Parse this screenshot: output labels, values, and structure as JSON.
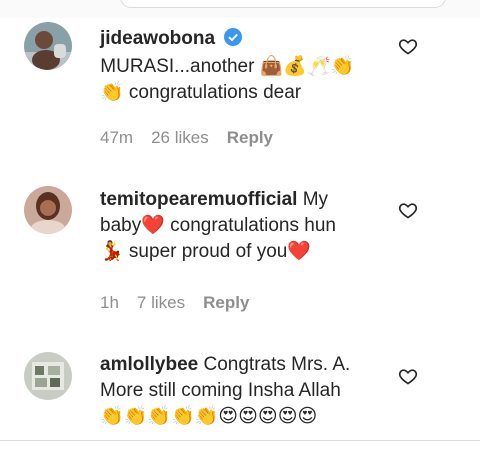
{
  "comments": [
    {
      "username": "jideawobona",
      "verified": true,
      "line1": " MURASI...another 👜💰🥂👏",
      "line2": "👏 congratulations dear",
      "time": "47m",
      "likes": "26 likes",
      "reply": "Reply"
    },
    {
      "username": "temitopearemuofficial",
      "verified": false,
      "line1": " My",
      "line2": "baby❤️ congratulations hun",
      "line3": "💃 super proud of you❤️",
      "time": "1h",
      "likes": "7 likes",
      "reply": "Reply"
    },
    {
      "username": "amlollybee",
      "verified": false,
      "line1": " Congtrats Mrs. A.",
      "line2": "More still coming Insha Allah",
      "line3": "👏👏👏👏👏😍😍😍😍😍"
    }
  ],
  "icons": {
    "like": "heart-outline-icon",
    "verified": "verified-badge-icon"
  },
  "colors": {
    "verified": "#3897f0",
    "heart_red": "#ed4956",
    "meta_grey": "#8e8e8e"
  }
}
